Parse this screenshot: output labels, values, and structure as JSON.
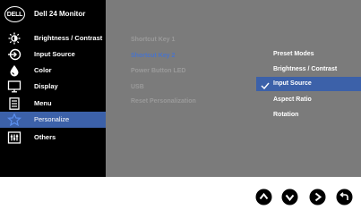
{
  "osd": {
    "logo_text": "DELL",
    "title": "Dell 24 Monitor"
  },
  "menu": {
    "items": [
      {
        "label": "Brightness / Contrast",
        "icon": "brightness-icon"
      },
      {
        "label": "Input Source",
        "icon": "input-source-icon"
      },
      {
        "label": "Color",
        "icon": "color-drop-icon"
      },
      {
        "label": "Display",
        "icon": "display-icon"
      },
      {
        "label": "Menu",
        "icon": "menu-list-icon"
      },
      {
        "label": "Personalize",
        "icon": "star-icon"
      },
      {
        "label": "Others",
        "icon": "others-icon"
      }
    ],
    "active_index": 5
  },
  "submenu": {
    "items": [
      {
        "label": "Shortcut Key 1"
      },
      {
        "label": "Shortcut Key 2"
      },
      {
        "label": "Power Button LED"
      },
      {
        "label": "USB"
      },
      {
        "label": "Reset Personalization"
      }
    ],
    "selected_index": 1
  },
  "options": {
    "items": [
      {
        "label": "Preset Modes"
      },
      {
        "label": "Brightness / Contrast"
      },
      {
        "label": "Input Source"
      },
      {
        "label": "Aspect Ratio"
      },
      {
        "label": "Rotation"
      }
    ],
    "selected_index": 2
  },
  "nav_buttons": [
    {
      "icon": "arrow-up-icon"
    },
    {
      "icon": "arrow-down-icon"
    },
    {
      "icon": "arrow-right-icon"
    },
    {
      "icon": "back-icon"
    }
  ],
  "colors": {
    "sidebar": "#000000",
    "panel": "#7b7b7b",
    "highlight": "#3c61a9"
  }
}
